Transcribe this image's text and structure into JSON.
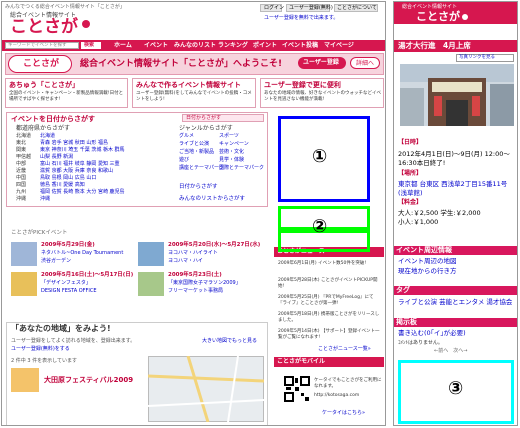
{
  "left": {
    "top_tagline": "みんなでつくる総合イベント情報サイト「ことさが」",
    "brand_small": "総合イベント情報サイト",
    "brand_logo": "ことさが",
    "top_links": [
      "ログイン",
      "ユーザー登録(無料)",
      "ことさがについて"
    ],
    "top_notice": "ユーザー登録を無料で出来ます。",
    "search_placeholder": "キーワードでイベントを探す",
    "search_button": "検索",
    "nav": [
      "ホーム",
      "イベント",
      "みんなのリスト",
      "ランキング",
      "ポイント",
      "イベント投稿",
      "マイページ"
    ],
    "banner_title": "総合イベント情報サイト「ことさが」へようこそ!",
    "banner_button": "ユーザー登録",
    "banner_detail": "詳細へ",
    "promos": [
      {
        "title": "あちゅう「ことさが」",
        "body": "全国のイベント・キャンペーン・新製品情報満載!日付と場所ですばやく探せます!"
      },
      {
        "title": "みんなで作るイベント情報サイト",
        "body": "ユーザー登録(無料)をしてみんなでイベントの投稿・コメントをしよう!"
      },
      {
        "title": "ユーザー登録で更に便利",
        "body": "あなたの地域の情報、好きなイベントのウォッチなどイベントを見逃さない機能が満載!"
      }
    ],
    "date_search_title": "イベントを日付からさがす",
    "place_search_title": "都道府県からさがす",
    "genre_search_title": "ジャンルからさがす",
    "date_search_label": "日付からさがす",
    "list_search_label": "みんなのリストからさがす",
    "genres": [
      "グルメ",
      "スポーツ",
      "ライブと公演",
      "キャンペーン",
      "ご当地・新製品",
      "芸術・文化",
      "遊び",
      "見学・体験",
      "講座とテーマパーク",
      "国際とテーマパーク"
    ],
    "regions": [
      {
        "name": "北海道",
        "prefs": "北海道"
      },
      {
        "name": "東北",
        "prefs": "青森 岩手 宮城 秋田 山形 福島"
      },
      {
        "name": "関東",
        "prefs": "東京 神奈川 埼玉 千葉 茨城 栃木 群馬"
      },
      {
        "name": "甲信越",
        "prefs": "山梨 長野 新潟"
      },
      {
        "name": "中部",
        "prefs": "富山 石川 福井 岐阜 静岡 愛知 三重"
      },
      {
        "name": "近畿",
        "prefs": "滋賀 京都 大阪 兵庫 奈良 和歌山"
      },
      {
        "name": "中国",
        "prefs": "鳥取 島根 岡山 広島 山口"
      },
      {
        "name": "四国",
        "prefs": "徳島 香川 愛媛 高知"
      },
      {
        "name": "九州",
        "prefs": "福岡 佐賀 長崎 熊本 大分 宮崎 鹿児島"
      },
      {
        "name": "沖縄",
        "prefs": "沖縄"
      }
    ],
    "pickup_title": "ことさがPICKイベント",
    "events": [
      {
        "date": "2009年5月29日(金)",
        "title": "ネタバトル~One Day Tournament",
        "place": "渋谷ガーデン"
      },
      {
        "date": "2009年5月20日(水)～5月27日(水)",
        "title": "ヨコハマ・ハイライト",
        "place": "ヨコハマ・ハイ"
      },
      {
        "date": "2009年5月16日(土)～5月17日(日)",
        "title": "「デザインフェスタ」",
        "place": "DESIGN FESTA OFFICE"
      },
      {
        "date": "2009年5月23日(土)",
        "title": "「東京国際女子マラソン2009」",
        "place": "フリーマーケット事務局"
      }
    ],
    "area_title": "「あなたの地域」をみよう!",
    "area_note": "ユーザー登録をしてよく訪れる地域を、登録出来ます。",
    "area_link": "ユーザー登録(無料)をする",
    "area_step": "2 件中 3 件を表示しています",
    "map_link": "大きい地図でもっと見る",
    "area_event_title": "大田原フェスティバル2009",
    "news_title": "ことさがニュース",
    "news_items": [
      "2009年6月1日(月) イベント数50件を突破!",
      "2009年5月28日(木) ことさがイベントPICKUP開始!",
      "2009年5月25日(月) 『PRでMyFreeLog』にて『ライブ』とことさが第一弾!",
      "2009年5月18日(月) 携帯版ことさがをリリースしました。",
      "2009年5月14日(木) 【サポート】登録イベント一覧がご覧になれます!"
    ],
    "news_more": "ことさがニュース一覧»",
    "mobile_title": "ことさがモバイル",
    "mobile_body": "ケータイでもことさがをご利用になれます。",
    "mobile_url": "http://kotosaga.com",
    "mobile_link": "ケータイはこちら»"
  },
  "right": {
    "brand_small": "総合イベント情報サイト",
    "brand_logo": "ことさが",
    "event_title": "湯才大行進　4月上席",
    "photo_button": "写真リンクを見る",
    "date_label": "【日時】",
    "date_value": "2012年4月1日(日)～9日(月) 12:00～16:30本日終了!",
    "place_label": "【場所】",
    "place_value": "東京都 台東区 西浅草2丁目15番11号(浅草館)",
    "price_label": "【料金】",
    "price_value": "大人:￥2,500 学生:￥2,000 小人:￥1,000",
    "section_info": "イベント周辺情報",
    "info_links": [
      "イベント周辺の地図",
      "現在地からの行き方"
    ],
    "section_tag": "タグ",
    "tags": "ライブと公演 芸能とエンタメ 湯才協会",
    "section_board": "掲示板",
    "board_link": "書き込む(0｢イ｣が必要)",
    "board_note": "ｺﾒﾝﾄはありません。",
    "pager": "←前へ　次へ→"
  },
  "annotations": [
    "①",
    "②",
    "③"
  ],
  "colors": {
    "brand": "#d6174f",
    "annotation_blue": "#0000ff",
    "annotation_green": "#00ff00",
    "annotation_cyan": "#00ffff"
  }
}
